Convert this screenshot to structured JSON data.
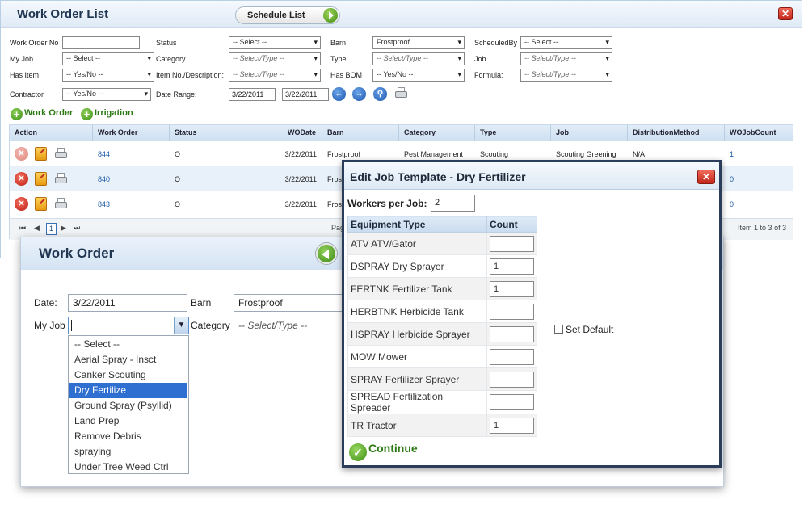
{
  "work_order_list": {
    "title": "Work Order List",
    "schedule_button": "Schedule List",
    "filters": {
      "work_order_no": {
        "label": "Work Order No",
        "value": ""
      },
      "status": {
        "label": "Status",
        "value": "-- Select --"
      },
      "barn": {
        "label": "Barn",
        "value": "Frostproof"
      },
      "scheduled_by": {
        "label": "ScheduledBy",
        "value": "-- Select --"
      },
      "my_job": {
        "label": "My Job",
        "value": "-- Select --"
      },
      "category": {
        "label": "Category",
        "value": "-- Select/Type --"
      },
      "type": {
        "label": "Type",
        "value": "-- Select/Type --"
      },
      "job": {
        "label": "Job",
        "value": "-- Select/Type --"
      },
      "has_item": {
        "label": "Has Item",
        "value": "-- Yes/No --"
      },
      "item_no": {
        "label": "Item No./Description:",
        "value": "-- Select/Type --"
      },
      "has_bom": {
        "label": "Has BOM",
        "value": "-- Yes/No --"
      },
      "formula": {
        "label": "Formula:",
        "value": "-- Select/Type --"
      },
      "contractor": {
        "label": "Contractor",
        "value": "-- Yes/No --"
      },
      "date_range": {
        "label": "Date Range:",
        "from": "3/22/2011",
        "sep": "-",
        "to": "3/22/2011"
      }
    },
    "add_work_order": "Work Order",
    "add_irrigation": "Irrigation",
    "grid": {
      "headers": [
        "Action",
        "Work Order",
        "Status",
        "WODate",
        "Barn",
        "Category",
        "Type",
        "Job",
        "DistributionMethod",
        "WOJobCount"
      ],
      "rows": [
        {
          "work_order": "844",
          "status": "O",
          "wodate": "3/22/2011",
          "barn": "Frostproof",
          "category": "Pest Management",
          "type": "Scouting",
          "job": "Scouting Greening",
          "distribution": "N/A",
          "count": "1"
        },
        {
          "work_order": "840",
          "status": "O",
          "wodate": "3/22/2011",
          "barn": "Frost",
          "category": "",
          "type": "",
          "job": "",
          "distribution": "",
          "count": "0"
        },
        {
          "work_order": "843",
          "status": "O",
          "wodate": "3/22/2011",
          "barn": "Frost",
          "category": "",
          "type": "",
          "job": "",
          "distribution": "",
          "count": "0"
        }
      ],
      "pager": {
        "current": "1",
        "page_text": "Pag",
        "item_prefix": "Item ",
        "from": "1",
        "to_word": " to ",
        "to": "3",
        "of_word": " of ",
        "total": "3"
      }
    }
  },
  "work_order": {
    "title": "Work Order",
    "date_label": "Date:",
    "date_value": "3/22/2011",
    "barn_label": "Barn",
    "barn_value": "Frostproof",
    "my_job_label": "My Job",
    "category_label": "Category",
    "category_value": "-- Select/Type --",
    "job_options": [
      "-- Select --",
      "Aerial Spray - Insct",
      "Canker Scouting",
      "Dry Fertilize",
      "Ground Spray (Psyllid)",
      "Land Prep",
      "Remove Debris",
      "spraying",
      "Under Tree Weed Ctrl"
    ],
    "selected_option": "Dry Fertilize"
  },
  "edit_job_template": {
    "title": "Edit Job Template - Dry Fertilizer",
    "workers_label": "Workers per Job:",
    "workers_value": "2",
    "col_equipment": "Equipment Type",
    "col_count": "Count",
    "equipment": [
      {
        "name": "ATV ATV/Gator",
        "count": ""
      },
      {
        "name": "DSPRAY Dry Sprayer",
        "count": "1"
      },
      {
        "name": "FERTNK Fertilizer Tank",
        "count": "1"
      },
      {
        "name": "HERBTNK Herbicide Tank",
        "count": ""
      },
      {
        "name": "HSPRAY Herbicide Sprayer",
        "count": ""
      },
      {
        "name": "MOW Mower",
        "count": ""
      },
      {
        "name": "SPRAY Fertilizer Sprayer",
        "count": ""
      },
      {
        "name": "SPREAD Fertilization Spreader",
        "count": ""
      },
      {
        "name": "TR Tractor",
        "count": "1"
      }
    ],
    "set_default": "Set Default",
    "continue": "Continue"
  }
}
